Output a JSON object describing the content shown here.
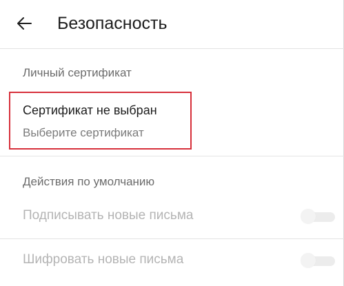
{
  "header": {
    "title": "Безопасность",
    "back_icon": "arrow-left-icon"
  },
  "personal_certificate": {
    "section_label": "Личный сертификат",
    "status": "Сертификат не выбран",
    "action": "Выберите сертификат",
    "highlight_color": "#d72f3a"
  },
  "default_actions": {
    "section_label": "Действия по умолчанию",
    "items": [
      {
        "label": "Подписывать новые письма",
        "enabled": false
      },
      {
        "label": "Шифровать новые письма",
        "enabled": false
      }
    ]
  }
}
